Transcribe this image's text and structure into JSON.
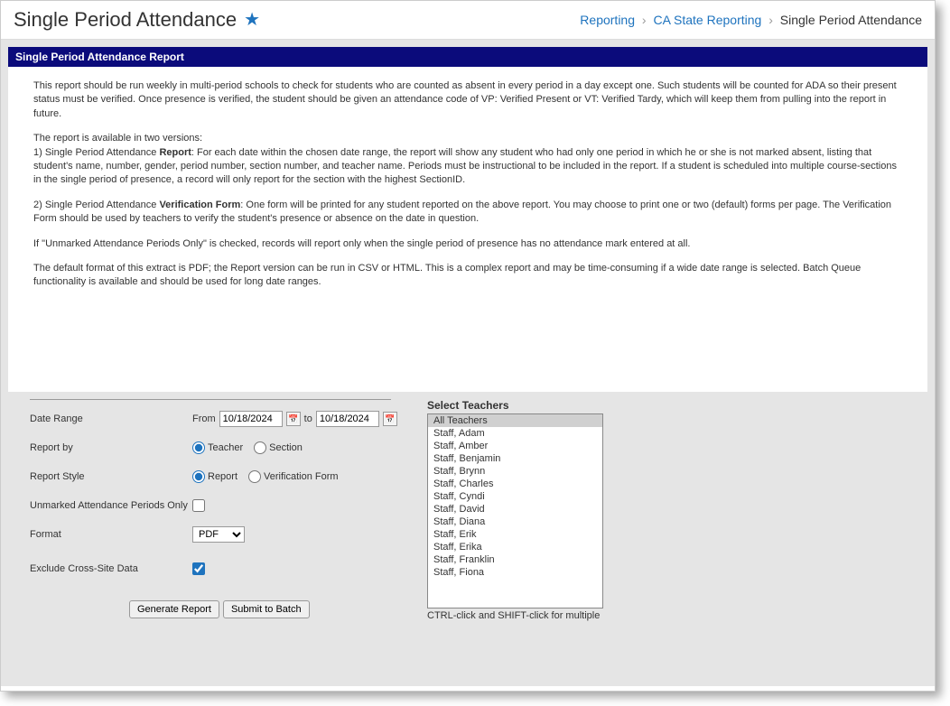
{
  "page": {
    "title": "Single Period Attendance"
  },
  "breadcrumb": {
    "reporting": "Reporting",
    "ca_state": "CA State Reporting",
    "current": "Single Period Attendance"
  },
  "panel": {
    "title": "Single Period Attendance Report"
  },
  "description": {
    "p1": "This report should be run weekly in multi-period schools to check for students who are counted as absent in every period in a day except one. Such students will be counted for ADA so their present status must be verified. Once presence is verified, the student should be given an attendance code of VP: Verified Present or VT: Verified Tardy, which will keep them from pulling into the report in future.",
    "p2_intro": "The report is available in two versions:",
    "p2_1a": "1) Single Period Attendance ",
    "p2_1b": "Report",
    "p2_1c": ": For each date within the chosen date range, the report will show any student who had only one period in which he or she is not marked absent, listing that student's name, number, gender, period number, section number, and teacher name. Periods must be instructional to be included in the report. If a student is scheduled into multiple course-sections in the single period of presence, a record will only report for the section with the highest SectionID.",
    "p2_2a": "2) Single Period Attendance ",
    "p2_2b": "Verification Form",
    "p2_2c": ": One form will be printed for any student reported on the above report. You may choose to print one or two (default) forms per page. The Verification Form should be used by teachers to verify the student's presence or absence on the date in question.",
    "p3": "If \"Unmarked Attendance Periods Only\" is checked, records will report only when the single period of presence has no attendance mark entered at all.",
    "p4": "The default format of this extract is PDF; the Report version can be run in CSV or HTML. This is a complex report and may be time-consuming if a wide date range is selected. Batch Queue functionality is available and should be used for long date ranges."
  },
  "form": {
    "date_range_label": "Date Range",
    "from_label": "From",
    "from_value": "10/18/2024",
    "to_label": "to",
    "to_value": "10/18/2024",
    "report_by_label": "Report by",
    "report_by_teacher": "Teacher",
    "report_by_section": "Section",
    "report_style_label": "Report Style",
    "report_style_report": "Report",
    "report_style_verification": "Verification Form",
    "unmarked_label": "Unmarked Attendance Periods Only",
    "format_label": "Format",
    "format_value": "PDF",
    "exclude_label": "Exclude Cross-Site Data",
    "generate_btn": "Generate Report",
    "submit_batch_btn": "Submit to Batch"
  },
  "teachers": {
    "label": "Select Teachers",
    "hint": "CTRL-click and SHIFT-click for multiple",
    "options": [
      "All Teachers",
      "Staff, Adam",
      "Staff, Amber",
      "Staff, Benjamin",
      "Staff, Brynn",
      "Staff, Charles",
      "Staff, Cyndi",
      "Staff, David",
      "Staff, Diana",
      "Staff, Erik",
      "Staff, Erika",
      "Staff, Franklin",
      "Staff, Fiona"
    ],
    "selected_index": 0
  }
}
